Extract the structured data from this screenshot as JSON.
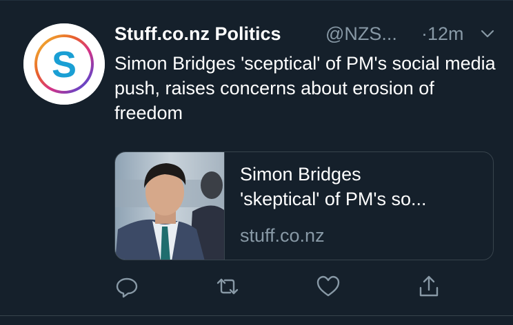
{
  "tweet": {
    "display_name": "Stuff.co.nz Politics",
    "handle": "@NZS...",
    "separator": "·",
    "time": "12m",
    "text": "Simon Bridges 'sceptical' of PM's social media push, raises concerns about erosion of freedom",
    "avatar_letter": "S"
  },
  "card": {
    "title": "Simon Bridges\n'skeptical' of PM's so...",
    "domain": "stuff.co.nz"
  },
  "actions": {
    "icons": [
      "reply-icon",
      "retweet-icon",
      "like-icon",
      "share-icon"
    ]
  },
  "colors": {
    "background": "#15202b",
    "text": "#ffffff",
    "secondary_text": "#8899a6",
    "border": "#38444d",
    "avatar_letter": "#1a9fd4"
  }
}
